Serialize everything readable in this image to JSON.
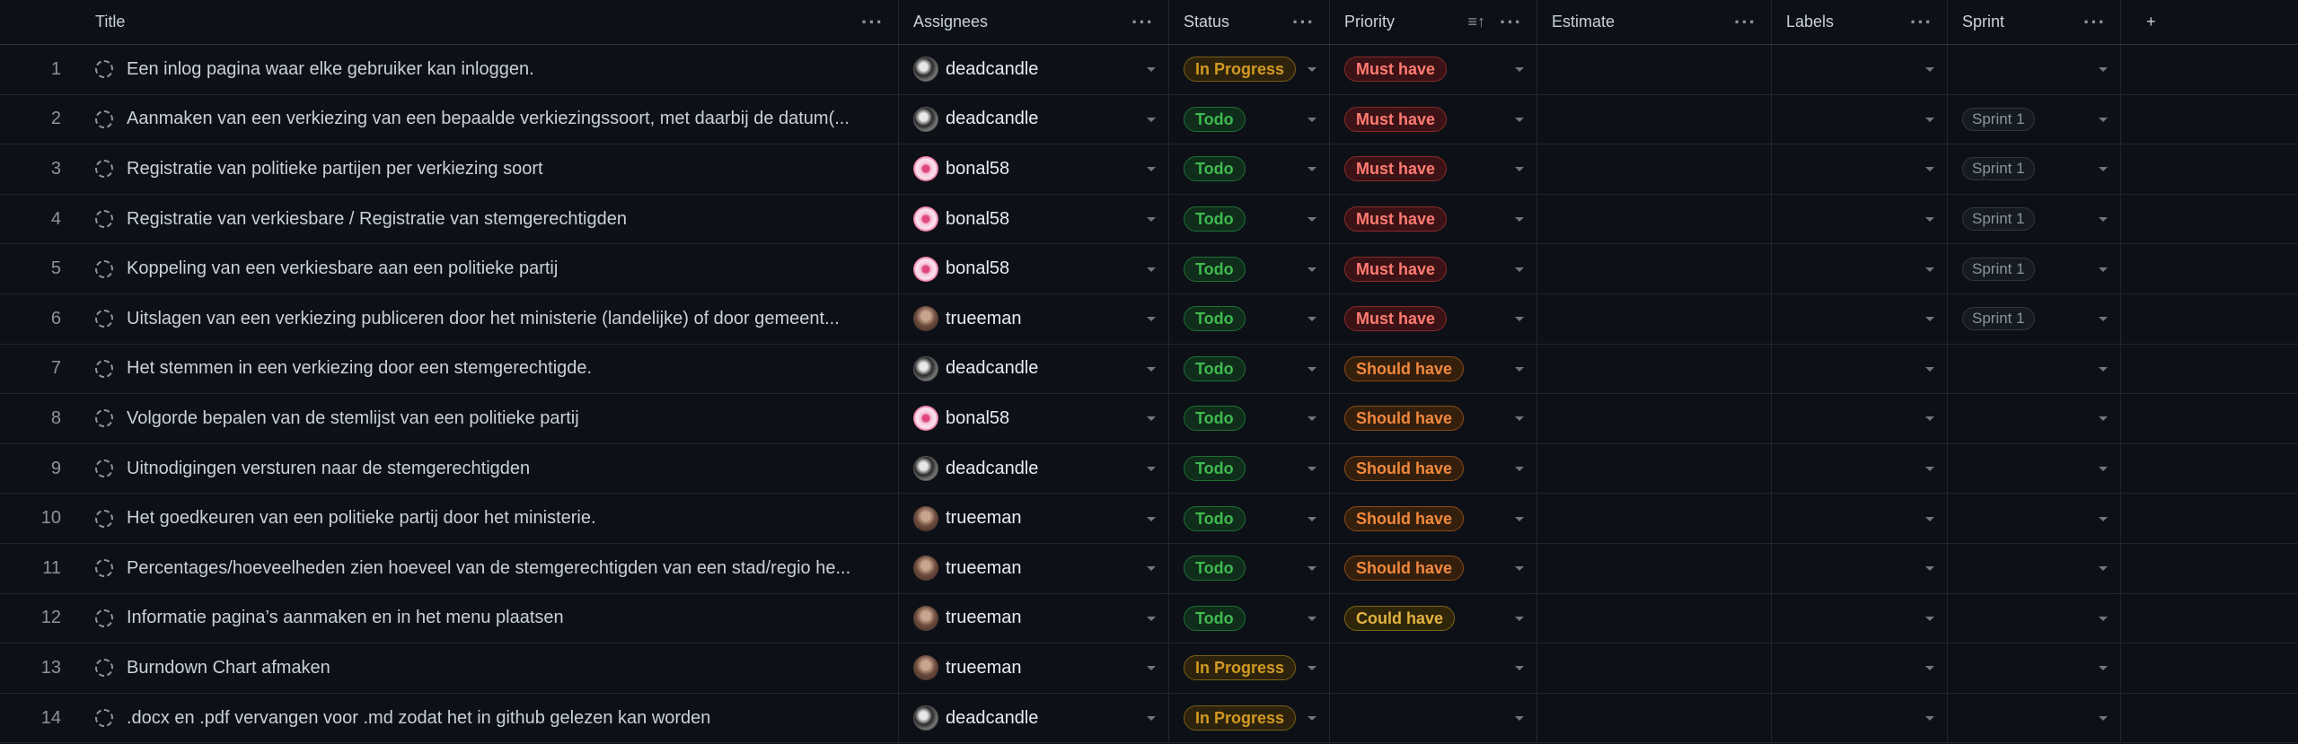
{
  "columns": {
    "title": "Title",
    "assignees": "Assignees",
    "status": "Status",
    "priority": "Priority",
    "estimate": "Estimate",
    "labels": "Labels",
    "sprint": "Sprint"
  },
  "icons": {
    "more": "more-horizontal-icon",
    "sort": "sort-ascending-icon",
    "add": "plus-icon",
    "issue": "draft-issue-icon",
    "caret": "chevron-down-icon"
  },
  "add_column_glyph": "+",
  "more_glyph": "···",
  "sort_glyph": "≡↑",
  "rows": [
    {
      "num": "1",
      "title": "Een inlog pagina waar elke gebruiker kan inloggen.",
      "assignee": "deadcandle",
      "status": "In Progress",
      "priority": "Must have",
      "sprint": ""
    },
    {
      "num": "2",
      "title": "Aanmaken van een verkiezing van een bepaalde verkiezingssoort, met daarbij de datum(...",
      "assignee": "deadcandle",
      "status": "Todo",
      "priority": "Must have",
      "sprint": "Sprint 1"
    },
    {
      "num": "3",
      "title": "Registratie van politieke partijen per verkiezing soort",
      "assignee": "bonal58",
      "status": "Todo",
      "priority": "Must have",
      "sprint": "Sprint 1"
    },
    {
      "num": "4",
      "title": "Registratie van verkiesbare / Registratie van stemgerechtigden",
      "assignee": "bonal58",
      "status": "Todo",
      "priority": "Must have",
      "sprint": "Sprint 1"
    },
    {
      "num": "5",
      "title": "Koppeling van een verkiesbare aan een politieke partij",
      "assignee": "bonal58",
      "status": "Todo",
      "priority": "Must have",
      "sprint": "Sprint 1"
    },
    {
      "num": "6",
      "title": "Uitslagen van een verkiezing publiceren door het ministerie (landelijke) of door gemeent...",
      "assignee": "trueeman",
      "status": "Todo",
      "priority": "Must have",
      "sprint": "Sprint 1"
    },
    {
      "num": "7",
      "title": "Het stemmen in een verkiezing door een stemgerechtigde.",
      "assignee": "deadcandle",
      "status": "Todo",
      "priority": "Should have",
      "sprint": ""
    },
    {
      "num": "8",
      "title": "Volgorde bepalen van de stemlijst van een politieke partij",
      "assignee": "bonal58",
      "status": "Todo",
      "priority": "Should have",
      "sprint": ""
    },
    {
      "num": "9",
      "title": "Uitnodigingen versturen naar de stemgerechtigden",
      "assignee": "deadcandle",
      "status": "Todo",
      "priority": "Should have",
      "sprint": ""
    },
    {
      "num": "10",
      "title": "Het goedkeuren van een politieke partij door het ministerie.",
      "assignee": "trueeman",
      "status": "Todo",
      "priority": "Should have",
      "sprint": ""
    },
    {
      "num": "11",
      "title": "Percentages/hoeveelheden zien hoeveel van de stemgerechtigden van een stad/regio he...",
      "assignee": "trueeman",
      "status": "Todo",
      "priority": "Should have",
      "sprint": ""
    },
    {
      "num": "12",
      "title": "Informatie pagina’s aanmaken en in het menu plaatsen",
      "assignee": "trueeman",
      "status": "Todo",
      "priority": "Could have",
      "sprint": ""
    },
    {
      "num": "13",
      "title": "Burndown Chart afmaken",
      "assignee": "trueeman",
      "status": "In Progress",
      "priority": "",
      "sprint": ""
    },
    {
      "num": "14",
      "title": ".docx en .pdf vervangen voor .md zodat het in github gelezen kan worden",
      "assignee": "deadcandle",
      "status": "In Progress",
      "priority": "",
      "sprint": ""
    }
  ],
  "colors": {
    "background": "#0d1117",
    "in_progress": "#d29922",
    "todo": "#3fb950",
    "must_have": "#ff7b72",
    "should_have": "#f0883e",
    "could_have": "#e3b341"
  }
}
